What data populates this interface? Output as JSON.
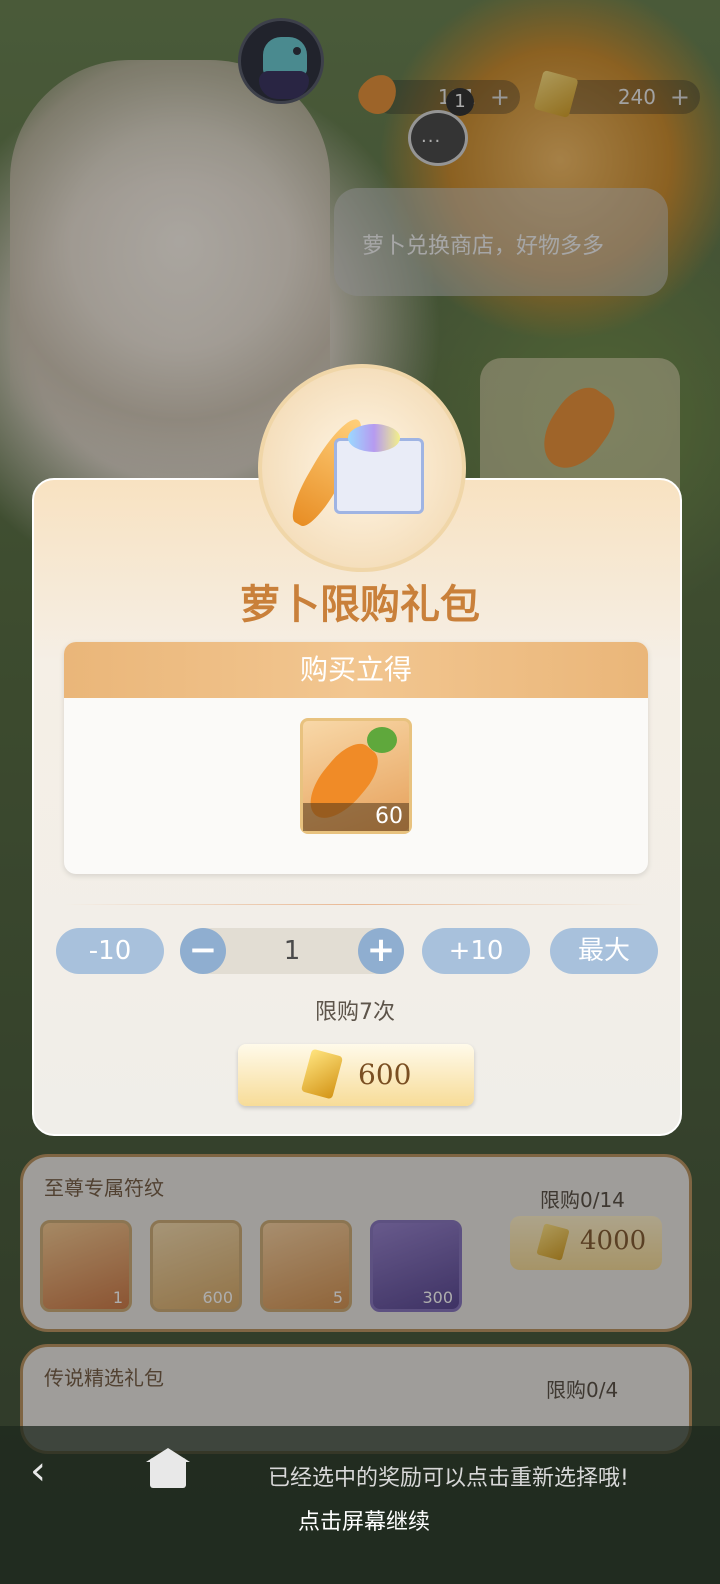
{
  "topbar": {
    "carrot_count": "111",
    "gem_count": "240",
    "plus": "+",
    "chat_badge": "1",
    "chat_glyph": "···"
  },
  "speech": {
    "text": "萝卜兑换商店，好物多多"
  },
  "modal": {
    "title": "萝卜限购礼包",
    "reward_header": "购买立得",
    "reward_item": {
      "icon": "carrot",
      "count": "60"
    },
    "minus10": "-10",
    "plus10": "+10",
    "max": "最大",
    "quantity": "1",
    "minus_glyph": "−",
    "plus_glyph": "+",
    "limit_text": "限购7次",
    "price": "600"
  },
  "list": {
    "panel1": {
      "title": "至尊专属符纹",
      "limit": "限购0/14",
      "price": "4000",
      "items": [
        {
          "count": "1"
        },
        {
          "count": "600"
        },
        {
          "count": "5"
        },
        {
          "count": "300"
        }
      ]
    },
    "panel2": {
      "title": "传说精选礼包",
      "limit": "限购0/4"
    }
  },
  "bottom": {
    "back_glyph": "‹",
    "hint": "已经选中的奖励可以点击重新选择哦!",
    "continue": "点击屏幕继续"
  },
  "colors": {
    "modal_title": "#c9803a",
    "reward_header": "#eab679",
    "pill": "#a8c1dc"
  }
}
